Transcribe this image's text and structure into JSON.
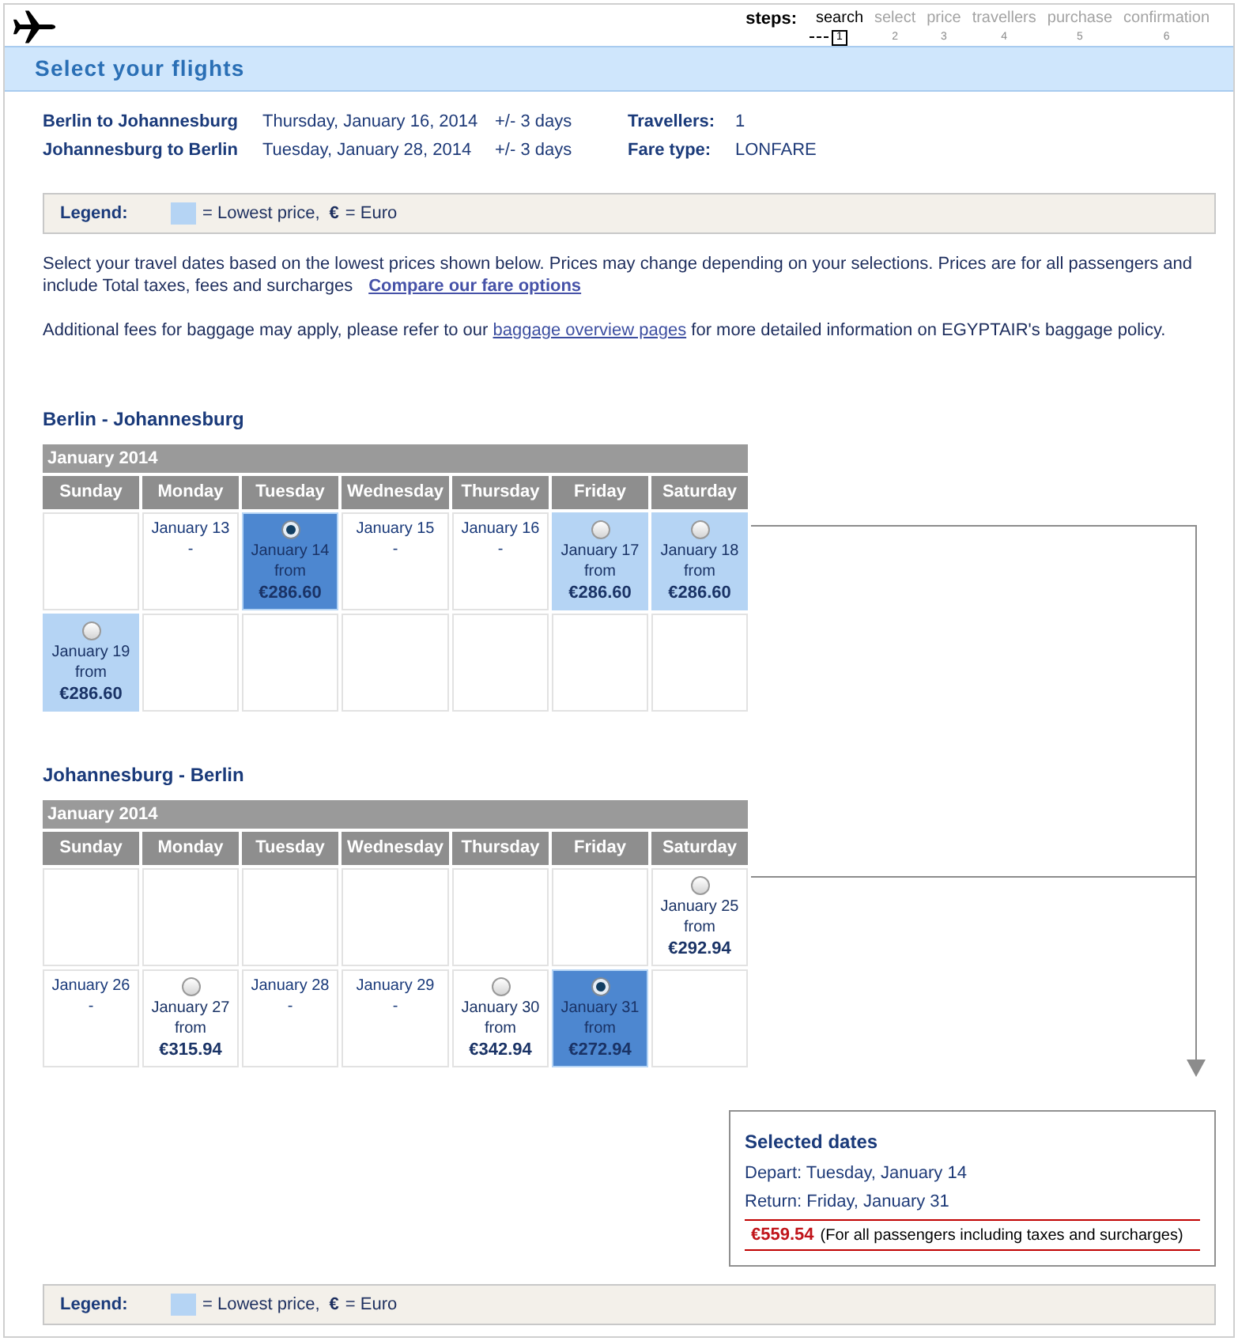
{
  "header": {
    "steps_label": "steps:",
    "steps": [
      {
        "label": "search",
        "number": "1",
        "selected": true
      },
      {
        "label": "select",
        "number": "2",
        "selected": false
      },
      {
        "label": "price",
        "number": "3",
        "selected": false
      },
      {
        "label": "travellers",
        "number": "4",
        "selected": false
      },
      {
        "label": "purchase",
        "number": "5",
        "selected": false
      },
      {
        "label": "confirmation",
        "number": "6",
        "selected": false
      }
    ]
  },
  "title": "Select your flights",
  "itinerary": [
    {
      "route": "Berlin to Johannesburg",
      "date": "Thursday, January 16, 2014",
      "flexibility": "+/- 3 days"
    },
    {
      "route": "Johannesburg to Berlin",
      "date": "Tuesday, January 28, 2014",
      "flexibility": "+/- 3 days"
    }
  ],
  "details": [
    {
      "label": "Travellers:",
      "value": "1"
    },
    {
      "label": "Fare type:",
      "value": "LONFARE"
    }
  ],
  "legend_top": {
    "label": "Legend:",
    "lowest_price": "= Lowest price,",
    "currency_symbol": "€",
    "currency": "= Euro"
  },
  "intro": {
    "text": "Select your travel dates based on the lowest prices shown below. Prices may change depending on your selections. Prices are for all passengers and include Total taxes, fees and surcharges",
    "link": "Compare our fare options"
  },
  "baggage_note": {
    "before": "Additional fees for baggage may apply, please refer to our",
    "link": "baggage overview pages",
    "after": "for more detailed information on EGYPTAIR's baggage policy."
  },
  "calendars": [
    {
      "title": "Berlin - Johannesburg",
      "month": "January 2014",
      "weekdays": [
        "Sunday",
        "Monday",
        "Tuesday",
        "Wednesday",
        "Thursday",
        "Friday",
        "Saturday"
      ],
      "weeks": [
        [
          {
            "kind": "empty"
          },
          {
            "kind": "no-fare",
            "date": "January 13",
            "fare": "-"
          },
          {
            "kind": "fare",
            "date": "January 14",
            "from": "from",
            "price": "€286.60",
            "selected": true,
            "lowest": true
          },
          {
            "kind": "no-fare",
            "date": "January 15",
            "fare": "-"
          },
          {
            "kind": "no-fare",
            "date": "January 16",
            "fare": "-"
          },
          {
            "kind": "fare",
            "date": "January 17",
            "from": "from",
            "price": "€286.60",
            "selected": false,
            "lowest": true
          },
          {
            "kind": "fare",
            "date": "January 18",
            "from": "from",
            "price": "€286.60",
            "selected": false,
            "lowest": true
          }
        ],
        [
          {
            "kind": "fare",
            "date": "January 19",
            "from": "from",
            "price": "€286.60",
            "selected": false,
            "lowest": true
          },
          {
            "kind": "empty"
          },
          {
            "kind": "empty"
          },
          {
            "kind": "empty"
          },
          {
            "kind": "empty"
          },
          {
            "kind": "empty"
          },
          {
            "kind": "empty"
          }
        ]
      ]
    },
    {
      "title": "Johannesburg - Berlin",
      "month": "January 2014",
      "weekdays": [
        "Sunday",
        "Monday",
        "Tuesday",
        "Wednesday",
        "Thursday",
        "Friday",
        "Saturday"
      ],
      "weeks": [
        [
          {
            "kind": "empty"
          },
          {
            "kind": "empty"
          },
          {
            "kind": "empty"
          },
          {
            "kind": "empty"
          },
          {
            "kind": "empty"
          },
          {
            "kind": "empty"
          },
          {
            "kind": "fare",
            "date": "January 25",
            "from": "from",
            "price": "€292.94",
            "selected": false,
            "lowest": false
          }
        ],
        [
          {
            "kind": "no-fare",
            "date": "January 26",
            "fare": "-"
          },
          {
            "kind": "fare",
            "date": "January 27",
            "from": "from",
            "price": "€315.94",
            "selected": false,
            "lowest": false
          },
          {
            "kind": "no-fare",
            "date": "January 28",
            "fare": "-"
          },
          {
            "kind": "no-fare",
            "date": "January 29",
            "fare": "-"
          },
          {
            "kind": "fare",
            "date": "January 30",
            "from": "from",
            "price": "€342.94",
            "selected": false,
            "lowest": false
          },
          {
            "kind": "fare",
            "date": "January 31",
            "from": "from",
            "price": "€272.94",
            "selected": true,
            "lowest": true
          },
          {
            "kind": "empty"
          }
        ]
      ]
    }
  ],
  "selected_dates": {
    "title": "Selected dates",
    "depart": "Depart: Tuesday, January 14",
    "return": "Return: Friday, January 31",
    "total": "€559.54",
    "note": "(For all passengers including taxes and surcharges)"
  },
  "legend_bottom": {
    "label": "Legend:",
    "lowest_price": "= Lowest price,",
    "currency_symbol": "€",
    "currency": "= Euro"
  }
}
